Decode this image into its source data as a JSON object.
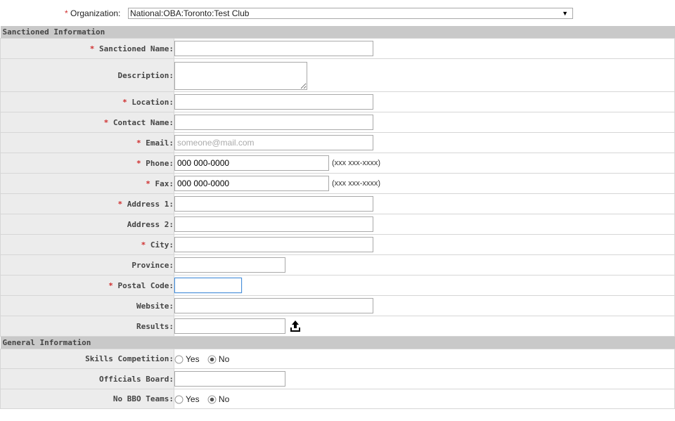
{
  "organization": {
    "label": "Organization:",
    "required_mark": "*",
    "selected": "National:OBA:Toronto:Test Club",
    "arrow": "▼"
  },
  "sections": {
    "sanctioned": "Sanctioned Information",
    "general": "General Information"
  },
  "fields": {
    "sanctioned_name": {
      "label": "Sanctioned Name:",
      "value": ""
    },
    "description": {
      "label": "Description:",
      "value": ""
    },
    "location": {
      "label": "Location:",
      "value": ""
    },
    "contact_name": {
      "label": "Contact Name:",
      "value": ""
    },
    "email": {
      "label": "Email:",
      "value": "",
      "placeholder": "someone@mail.com"
    },
    "phone": {
      "label": "Phone:",
      "value": "000 000-0000",
      "hint": "(xxx xxx-xxxx)"
    },
    "fax": {
      "label": "Fax:",
      "value": "000 000-0000",
      "hint": "(xxx xxx-xxxx)"
    },
    "address1": {
      "label": "Address 1:",
      "value": ""
    },
    "address2": {
      "label": "Address 2:",
      "value": ""
    },
    "city": {
      "label": "City:",
      "value": ""
    },
    "province": {
      "label": "Province:",
      "value": ""
    },
    "postal_code": {
      "label": "Postal Code:",
      "value": ""
    },
    "website": {
      "label": "Website:",
      "value": ""
    },
    "results": {
      "label": "Results:",
      "value": "",
      "icon": "upload-icon"
    }
  },
  "general": {
    "skills_competition": {
      "label": "Skills Competition:",
      "options": [
        "Yes",
        "No"
      ],
      "selected": "No"
    },
    "officials_board": {
      "label": "Officials Board:",
      "value": ""
    },
    "no_bbo_teams": {
      "label": "No BBO Teams:",
      "options": [
        "Yes",
        "No"
      ],
      "selected": "No"
    }
  },
  "required_mark": "*",
  "colors": {
    "required": "#d03030",
    "section_bg": "#c9c9c9",
    "label_bg": "#ececec",
    "focus_border": "#4a90d9"
  }
}
